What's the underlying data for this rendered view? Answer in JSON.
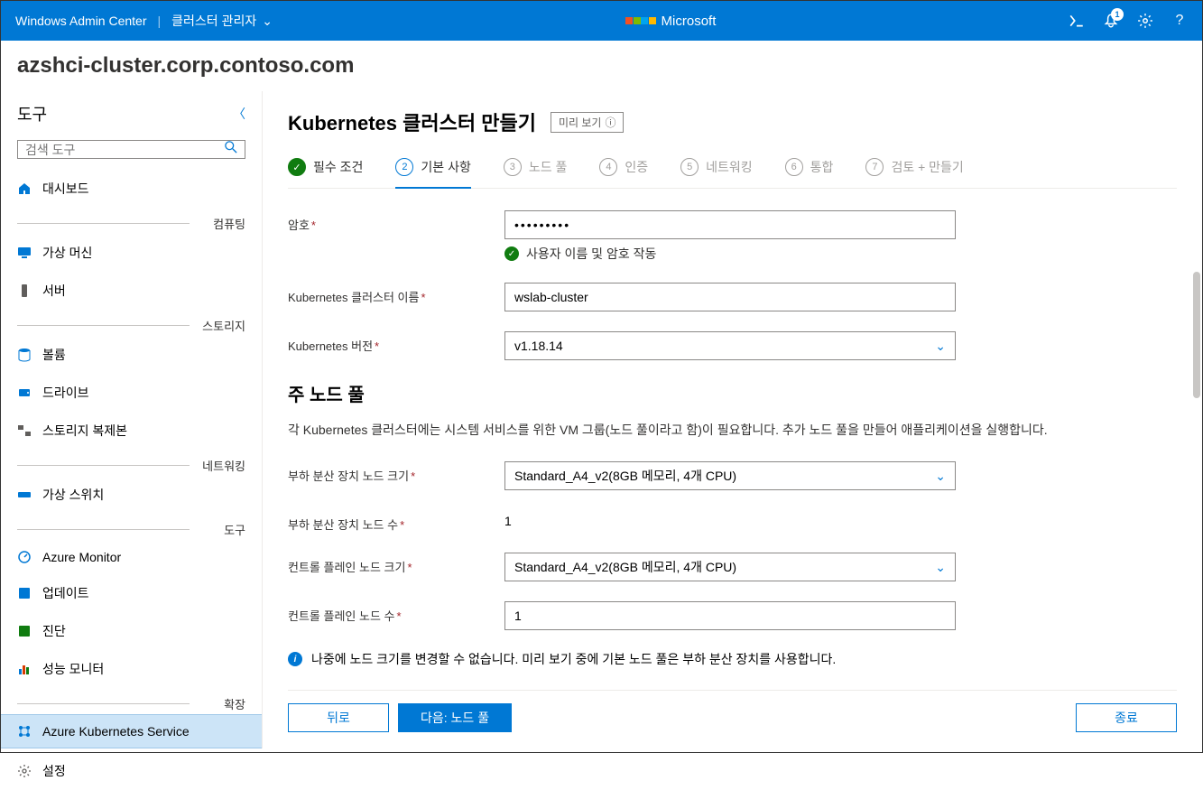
{
  "header": {
    "app_name": "Windows Admin Center",
    "context_label": "클러스터 관리자",
    "brand": "Microsoft",
    "notification_count": "1"
  },
  "cluster_name": "azshci-cluster.corp.contoso.com",
  "sidebar": {
    "title": "도구",
    "search_placeholder": "검색 도구",
    "sections": {
      "compute": "컴퓨팅",
      "storage": "스토리지",
      "networking": "네트워킹",
      "tools": "도구",
      "extensions": "확장"
    },
    "items": {
      "dashboard": "대시보드",
      "vms": "가상 머신",
      "servers": "서버",
      "volumes": "볼륨",
      "drives": "드라이브",
      "storage_replica": "스토리지 복제본",
      "vswitch": "가상 스위치",
      "azure_monitor": "Azure Monitor",
      "updates": "업데이트",
      "diagnostics": "진단",
      "perf_monitor": "성능 모니터",
      "aks": "Azure Kubernetes Service",
      "settings": "설정"
    }
  },
  "page": {
    "title": "Kubernetes 클러스터 만들기",
    "preview_badge": "미리 보기",
    "steps": {
      "s1": "필수 조건",
      "s2": "기본 사항",
      "s3": "노드 풀",
      "s4": "인증",
      "s5": "네트워킹",
      "s6": "통합",
      "s7": "검토 + 만들기"
    },
    "form": {
      "password_label": "암호",
      "password_value": "•••••••••",
      "validation_msg": "사용자 이름 및 암호 작동",
      "cluster_name_label": "Kubernetes 클러스터 이름",
      "cluster_name_value": "wslab-cluster",
      "version_label": "Kubernetes 버전",
      "version_value": "v1.18.14",
      "nodepool_heading": "주 노드 풀",
      "nodepool_desc": "각 Kubernetes 클러스터에는 시스템 서비스를 위한 VM 그룹(노드 풀이라고 함)이 필요합니다. 추가 노드 풀을 만들어 애플리케이션을 실행합니다.",
      "lb_size_label": "부하 분산 장치 노드 크기",
      "lb_size_value": "Standard_A4_v2(8GB 메모리, 4개 CPU)",
      "lb_count_label": "부하 분산 장치 노드 수",
      "lb_count_value": "1",
      "cp_size_label": "컨트롤 플레인 노드 크기",
      "cp_size_value": "Standard_A4_v2(8GB 메모리, 4개 CPU)",
      "cp_count_label": "컨트롤 플레인 노드 수",
      "cp_count_value": "1",
      "info_banner": "나중에 노드 크기를 변경할 수 없습니다. 미리 보기 중에 기본 노드 풀은 부하 분산 장치를 사용합니다."
    },
    "footer": {
      "back": "뒤로",
      "next": "다음: 노드 풀",
      "close": "종료"
    }
  }
}
